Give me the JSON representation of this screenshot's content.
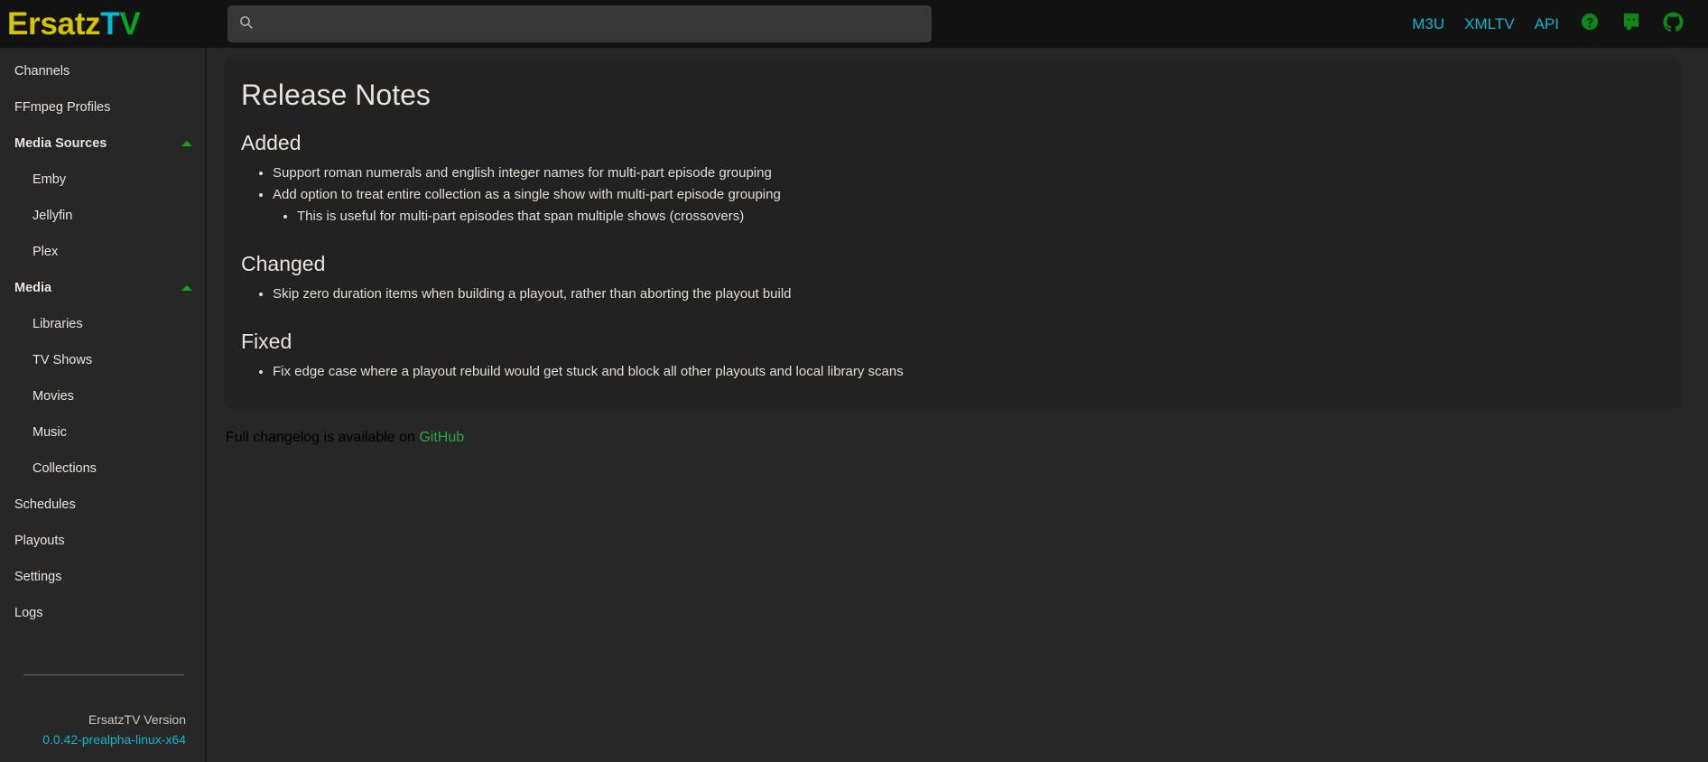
{
  "brand": {
    "part1": "Ersatz",
    "part2": "T",
    "part3": "V",
    "color_ersatz": "#d4c500",
    "color_t": "#00bcd4",
    "color_v": "#00a825"
  },
  "search": {
    "value": "",
    "placeholder": "",
    "icon": "search-icon"
  },
  "topnav": {
    "links": [
      {
        "label": "M3U"
      },
      {
        "label": "XMLTV"
      },
      {
        "label": "API"
      }
    ],
    "icons": [
      {
        "name": "help-circle-icon",
        "title": "Help"
      },
      {
        "name": "discord-icon",
        "title": "Discord"
      },
      {
        "name": "github-icon",
        "title": "GitHub"
      }
    ],
    "link_color": "#0fb6c7",
    "icon_color": "#0a8a12"
  },
  "sidebar": {
    "items": [
      {
        "label": "Channels",
        "type": "top"
      },
      {
        "label": "FFmpeg Profiles",
        "type": "top"
      },
      {
        "label": "Media Sources",
        "type": "group",
        "expanded": true,
        "icon": "chevron-up-icon"
      },
      {
        "label": "Emby",
        "type": "child"
      },
      {
        "label": "Jellyfin",
        "type": "child"
      },
      {
        "label": "Plex",
        "type": "child"
      },
      {
        "label": "Media",
        "type": "group",
        "expanded": true,
        "icon": "chevron-up-icon"
      },
      {
        "label": "Libraries",
        "type": "child"
      },
      {
        "label": "TV Shows",
        "type": "child"
      },
      {
        "label": "Movies",
        "type": "child"
      },
      {
        "label": "Music",
        "type": "child"
      },
      {
        "label": "Collections",
        "type": "child"
      },
      {
        "label": "Schedules",
        "type": "top"
      },
      {
        "label": "Playouts",
        "type": "top"
      },
      {
        "label": "Settings",
        "type": "top"
      },
      {
        "label": "Logs",
        "type": "top"
      }
    ],
    "footer": {
      "version_label": "ErsatzTV Version",
      "version_value": "0.0.42-prealpha-linux-x64"
    }
  },
  "main": {
    "page_title": "Release Notes",
    "sections": [
      {
        "heading": "Added",
        "items": [
          {
            "text": "Support roman numerals and english integer names for multi-part episode grouping",
            "children": []
          },
          {
            "text": "Add option to treat entire collection as a single show with multi-part episode grouping",
            "children": [
              "This is useful for multi-part episodes that span multiple shows (crossovers)"
            ]
          }
        ]
      },
      {
        "heading": "Changed",
        "items": [
          {
            "text": "Skip zero duration items when building a playout, rather than aborting the playout build",
            "children": []
          }
        ]
      },
      {
        "heading": "Fixed",
        "items": [
          {
            "text": "Fix edge case where a playout rebuild would get stuck and block all other playouts and local library scans",
            "children": []
          }
        ]
      }
    ],
    "changelog": {
      "prefix": "Full changelog is available on ",
      "link_label": "GitHub",
      "link_color": "#26a942"
    }
  }
}
